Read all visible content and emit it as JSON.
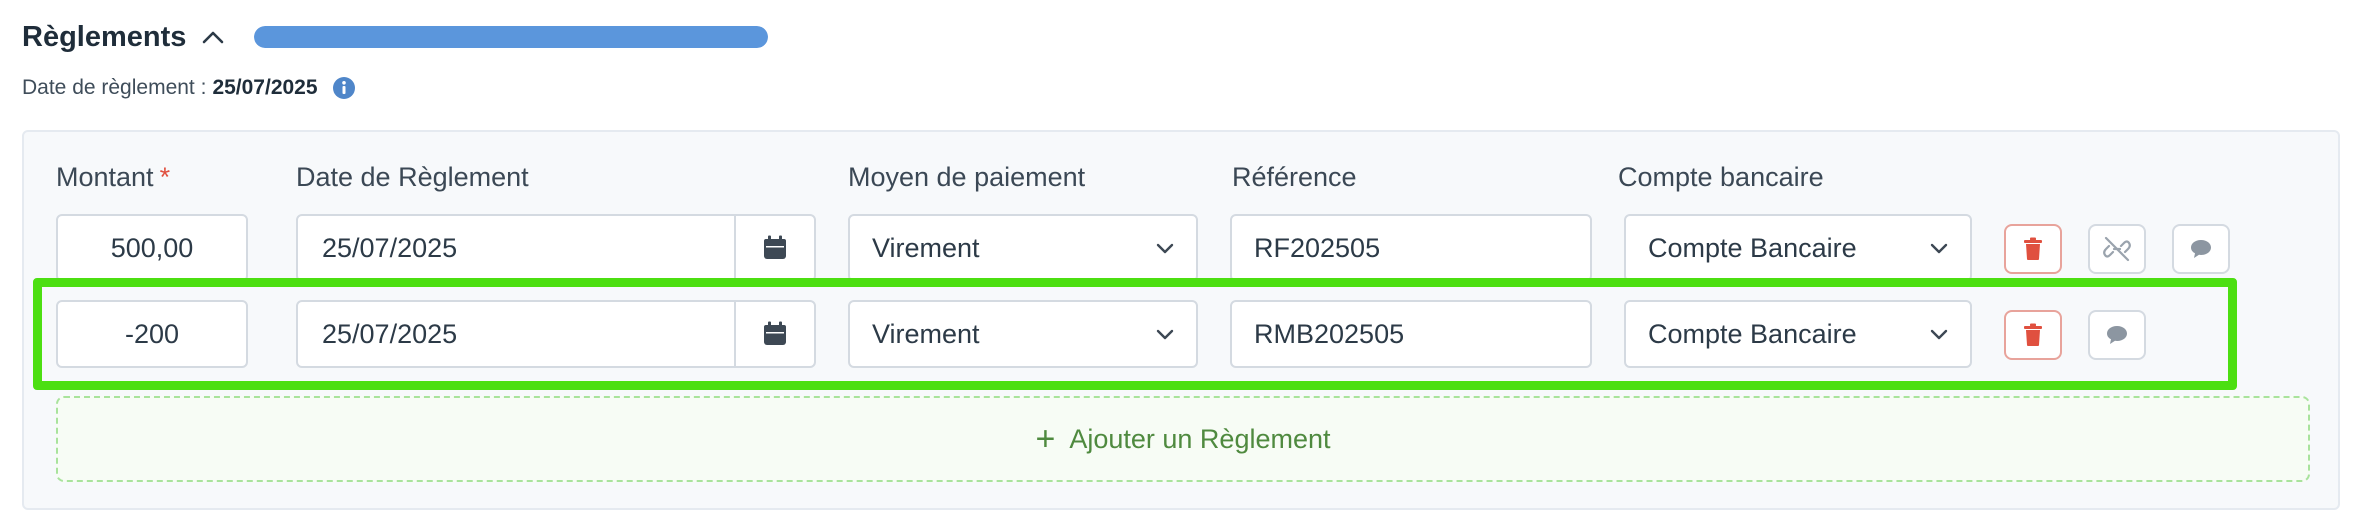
{
  "section": {
    "title": "Règlements",
    "progress_fraction": 1.0,
    "date_label": "Date de règlement :",
    "date_value": "25/07/2025"
  },
  "columns": {
    "amount": "Montant",
    "required_mark": "*",
    "date": "Date de Règlement",
    "payment_method": "Moyen de paiement",
    "reference": "Référence",
    "bank_account": "Compte bancaire"
  },
  "rows": [
    {
      "amount": "500,00",
      "date": "25/07/2025",
      "payment_method": "Virement",
      "reference": "RF202505",
      "bank_account": "Compte Bancaire",
      "actions": [
        "trash-icon",
        "unlink-icon",
        "comment-icon"
      ]
    },
    {
      "amount": "-200",
      "date": "25/07/2025",
      "payment_method": "Virement",
      "reference": "RMB202505",
      "bank_account": "Compte Bancaire",
      "actions": [
        "trash-icon",
        "comment-icon"
      ]
    }
  ],
  "add_button": {
    "label": "Ajouter un Règlement",
    "icon": "plus-icon"
  },
  "colors": {
    "progress": "#5b96dc",
    "highlight": "#4cdf11",
    "danger": "#e0503f",
    "add_accent": "#4f8a3f"
  }
}
